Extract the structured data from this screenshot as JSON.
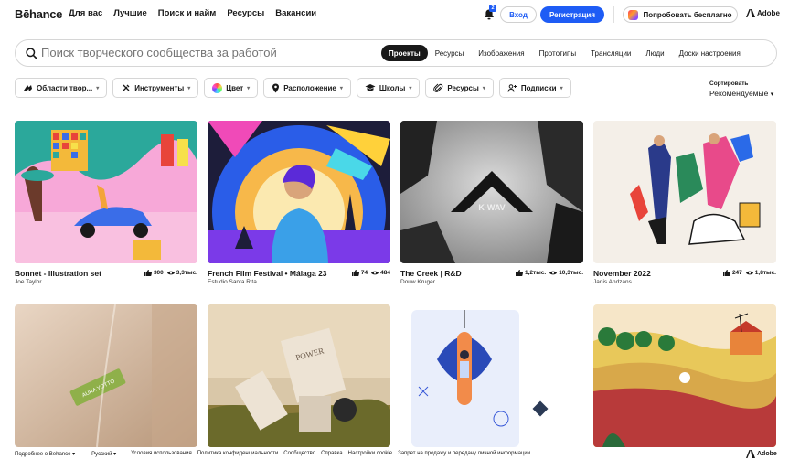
{
  "header": {
    "logo": "Bēhance",
    "nav": [
      "Для вас",
      "Лучшие",
      "Поиск и найм",
      "Ресурсы",
      "Вакансии"
    ],
    "notification_count": "2",
    "login_label": "Вход",
    "register_label": "Регистрация",
    "try_label": "Попробовать бесплатно",
    "adobe_label": "Adobe"
  },
  "search": {
    "placeholder": "Поиск творческого сообщества за работой",
    "tabs": [
      "Проекты",
      "Ресурсы",
      "Изображения",
      "Прототипы",
      "Трансляции",
      "Люди",
      "Доски настроения"
    ],
    "active_tab": "Проекты"
  },
  "filters": [
    "Области твор...",
    "Инструменты",
    "Цвет",
    "Расположение",
    "Школы",
    "Ресурсы",
    "Подписки"
  ],
  "sort": {
    "label": "Сортировать",
    "value": "Рекомендуемые"
  },
  "projects": [
    {
      "title": "Bonnet - Illustration set",
      "owner": "Joe Taylor",
      "likes": "300",
      "views": "3,3тыс."
    },
    {
      "title": "French Film Festival • Málaga 23",
      "owner": "Estudio Santa Rita .",
      "likes": "74",
      "views": "484"
    },
    {
      "title": "The Creek | R&D",
      "owner": "Douw Kruger",
      "likes": "1,2тыс.",
      "views": "10,3тыс."
    },
    {
      "title": "November 2022",
      "owner": "Janis Andzans",
      "likes": "247",
      "views": "1,8тыс."
    }
  ],
  "footer": {
    "links": [
      "Подробнее о Behance",
      "Русский",
      "Условия использования",
      "Политика конфиденциальности",
      "Сообщество",
      "Справка",
      "Настройки cookie",
      "Запрет на продажу и передачу личной информации"
    ],
    "adobe_label": "Adobe"
  },
  "colors": {
    "accent": "#1e5cf5",
    "text": "#191919",
    "border": "#d6d6d6"
  }
}
